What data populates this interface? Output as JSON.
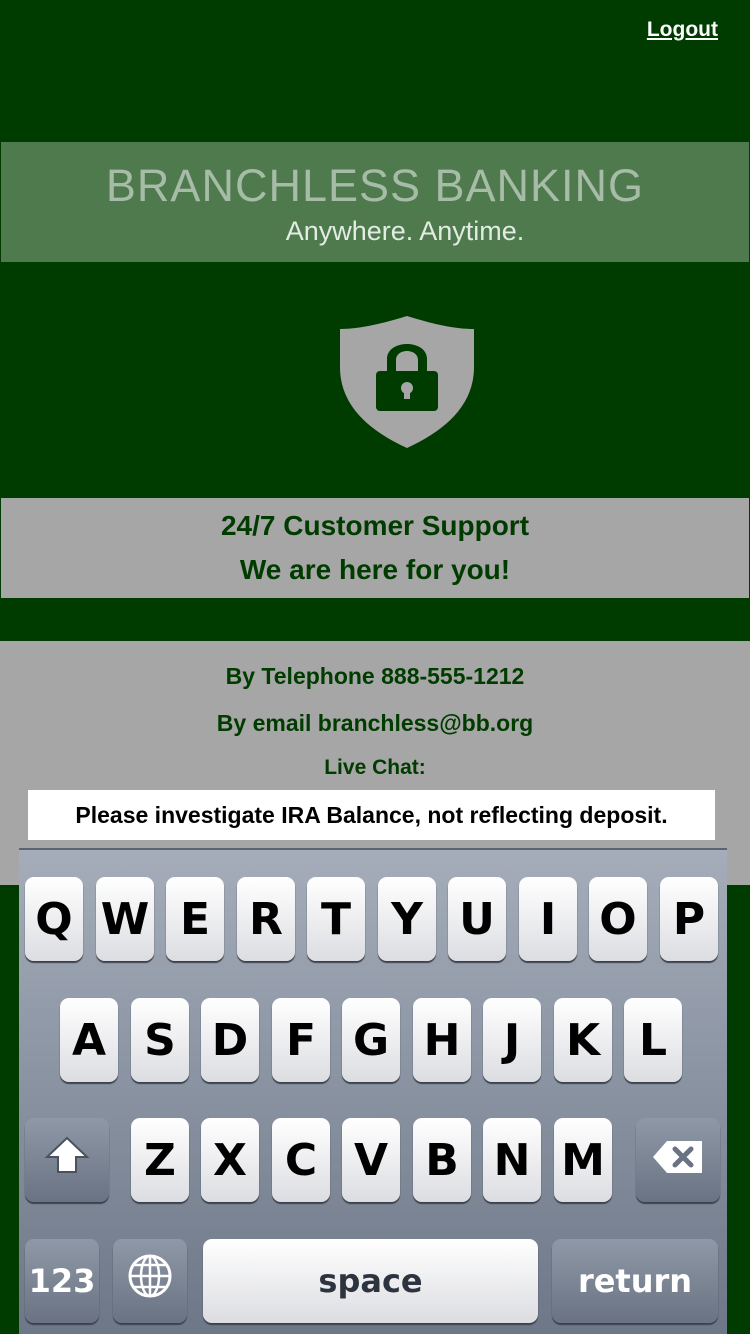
{
  "header": {
    "logout_label": "Logout"
  },
  "banner": {
    "title": "BRANCHLESS BANKING",
    "subtitle": "Anywhere.  Anytime."
  },
  "support": {
    "line1": "24/7 Customer Support",
    "line2": "We are here for you!"
  },
  "contact": {
    "telephone": "By Telephone 888-555-1212",
    "email": "By email branchless@bb.org",
    "live_chat_label": "Live Chat:",
    "chat_value": "Please investigate IRA Balance, not reflecting deposit."
  },
  "keyboard": {
    "row1": [
      "Q",
      "W",
      "E",
      "R",
      "T",
      "Y",
      "U",
      "I",
      "O",
      "P"
    ],
    "row2": [
      "A",
      "S",
      "D",
      "F",
      "G",
      "H",
      "J",
      "K",
      "L"
    ],
    "row3": [
      "Z",
      "X",
      "C",
      "V",
      "B",
      "N",
      "M"
    ],
    "numbers_label": "123",
    "space_label": "space",
    "return_label": "return",
    "shift_icon": "shift-icon",
    "delete_icon": "delete-icon",
    "globe_icon": "globe-icon"
  },
  "colors": {
    "background": "#003b00",
    "banner": "#4e7a4e",
    "panel": "#a6a6a6",
    "text_green": "#003b00"
  }
}
